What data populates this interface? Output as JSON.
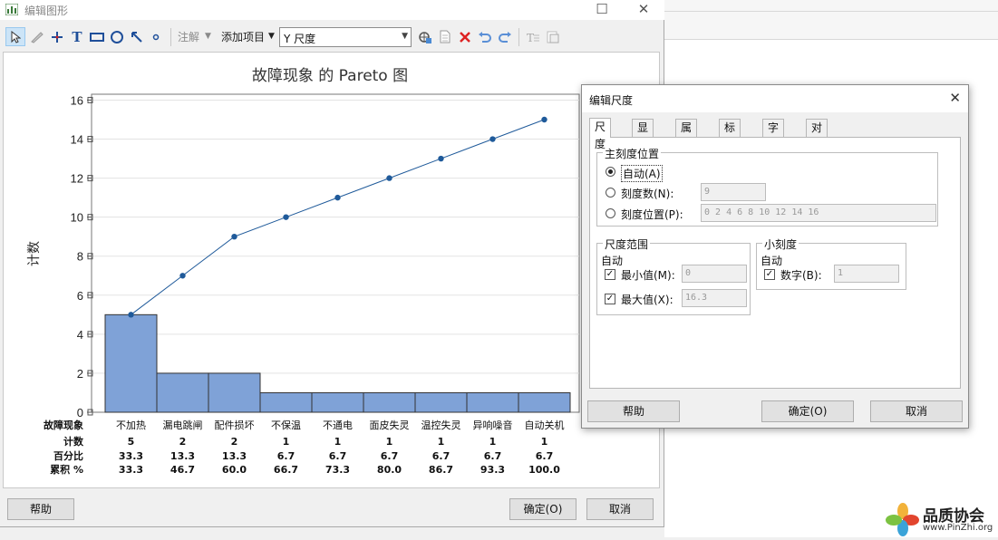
{
  "main_window": {
    "title": "编辑图形",
    "toolbar": {
      "annotate_label": "注解",
      "add_item_label": "添加项目",
      "scale_combo_value": "Y 尺度"
    },
    "help_button": "帮助",
    "ok_button": "确定(O)",
    "cancel_button": "取消"
  },
  "chart_data": {
    "type": "bar",
    "title": "故障现象 的 Pareto 图",
    "ylabel": "计数",
    "ylim": [
      0,
      16.3
    ],
    "yticks": [
      0,
      2,
      4,
      6,
      8,
      10,
      12,
      14,
      16
    ],
    "categories": [
      "不加热",
      "漏电跳闸",
      "配件损坏",
      "不保温",
      "不通电",
      "面皮失灵",
      "温控失灵",
      "异响噪音",
      "自动关机"
    ],
    "values": [
      5,
      2,
      2,
      1,
      1,
      1,
      1,
      1,
      1
    ],
    "cumulative_counts": [
      5,
      7,
      9,
      10,
      11,
      12,
      13,
      14,
      15
    ],
    "bar_color": "#7fa2d7",
    "line_color": "#1f5a9a",
    "table": {
      "row_labels": [
        "故障现象",
        "计数",
        "百分比",
        "累积 %"
      ],
      "counts": [
        "5",
        "2",
        "2",
        "1",
        "1",
        "1",
        "1",
        "1",
        "1"
      ],
      "percents": [
        "33.3",
        "13.3",
        "13.3",
        "6.7",
        "6.7",
        "6.7",
        "6.7",
        "6.7",
        "6.7"
      ],
      "cumulative": [
        "33.3",
        "46.7",
        "60.0",
        "66.7",
        "73.3",
        "80.0",
        "86.7",
        "93.3",
        "100.0"
      ]
    }
  },
  "dialog": {
    "title": "编辑尺度",
    "tabs": [
      "尺度",
      "显示",
      "属性",
      "标签",
      "字体",
      "对齐"
    ],
    "major_tick_group": "主刻度位置",
    "radio_auto": "自动(A)",
    "radio_count": "刻度数(N):",
    "radio_count_value": "9",
    "radio_positions": "刻度位置(P):",
    "radio_positions_value": "0 2 4 6 8 10 12 14 16",
    "range_group": "尺度范围",
    "range_auto": "自动",
    "min_label": "最小值(M):",
    "min_value": "0",
    "max_label": "最大值(X):",
    "max_value": "16.3",
    "minor_group": "小刻度",
    "minor_auto": "自动",
    "minor_number_label": "数字(B):",
    "minor_number_value": "1",
    "help_button": "帮助",
    "ok_button": "确定(O)",
    "cancel_button": "取消"
  },
  "watermark": {
    "brand": "品质协会",
    "url": "www.PinZhi.org"
  }
}
